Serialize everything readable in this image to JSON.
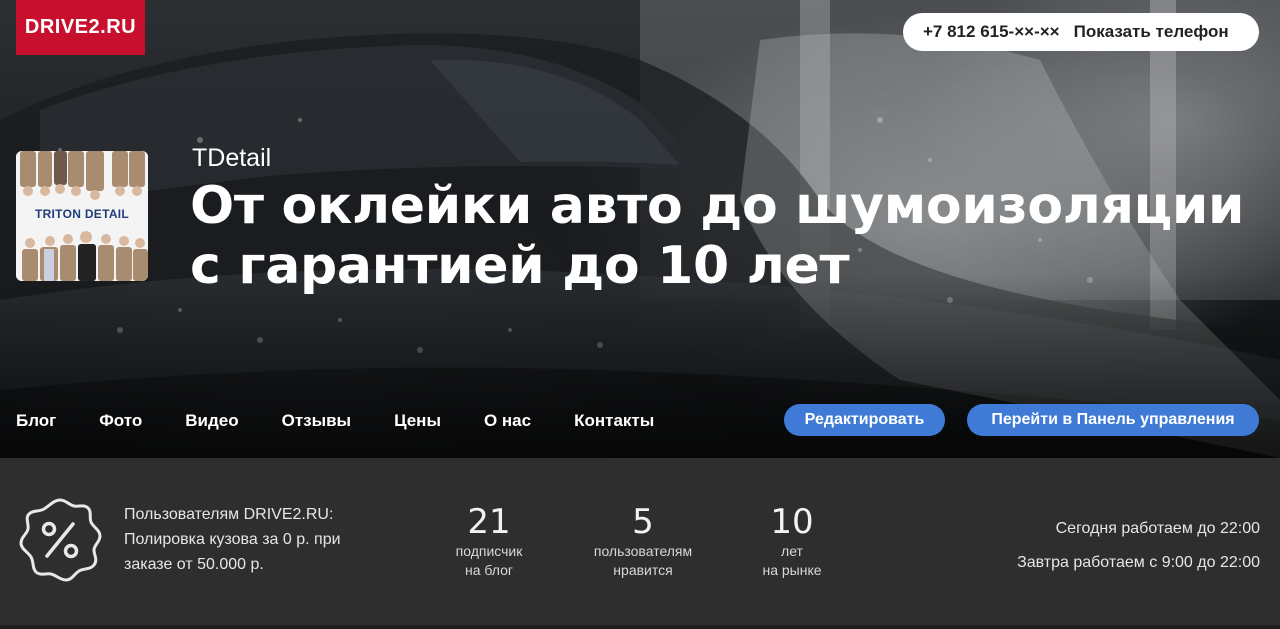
{
  "brand": {
    "logo_text": "DRIVE2.RU",
    "color": "#c8102e"
  },
  "header": {
    "phone_number": "+7 812 615-××-××",
    "show_phone_label": "Показать телефон"
  },
  "profile": {
    "avatar_text": "TRITON DETAIL",
    "company_name": "TDetail",
    "headline": "От оклейки авто до шумоизоляции с гарантией до 10 лет"
  },
  "nav": {
    "items": [
      {
        "label": "Блог"
      },
      {
        "label": "Фото"
      },
      {
        "label": "Видео"
      },
      {
        "label": "Отзывы"
      },
      {
        "label": "Цены"
      },
      {
        "label": "О нас"
      },
      {
        "label": "Контакты"
      }
    ]
  },
  "actions": {
    "edit_label": "Редактировать",
    "panel_label": "Перейти в Панель управления",
    "accent_color": "#3f7bd6"
  },
  "promo": {
    "icon": "percent-badge-icon",
    "text": "Пользователям DRIVE2.RU: Полировка кузова за 0 р. при заказе от 50.000 р."
  },
  "stats": [
    {
      "number": "21",
      "line1": "подписчик",
      "line2": "на блог"
    },
    {
      "number": "5",
      "line1": "пользователям",
      "line2": "нравится"
    },
    {
      "number": "10",
      "line1": "лет",
      "line2": "на рынке"
    }
  ],
  "hours": {
    "today": "Сегодня работаем до 22:00",
    "tomorrow": "Завтра работаем с 9:00 до 22:00"
  }
}
